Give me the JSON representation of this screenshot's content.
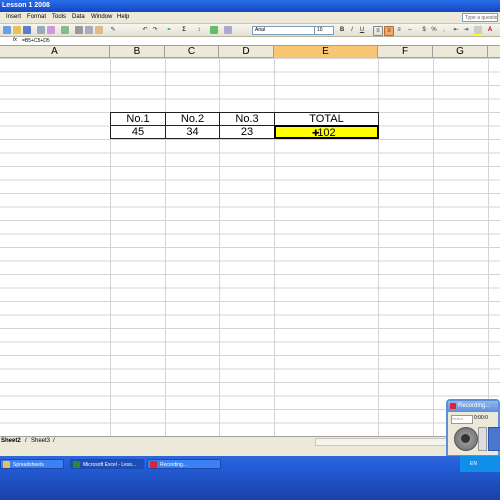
{
  "window": {
    "title": "Lesson 1 2008"
  },
  "menu": {
    "items": [
      "Insert",
      "Format",
      "Tools",
      "Data",
      "Window",
      "Help"
    ],
    "help_placeholder": "Type a questio"
  },
  "toolbar": {
    "font_name": "Arial",
    "font_size": "10",
    "bold": "B",
    "italic": "I",
    "underline": "U"
  },
  "formula_bar": {
    "fx": "fx",
    "formula": "=B5+C5+D5"
  },
  "columns": [
    "A",
    "B",
    "C",
    "D",
    "E",
    "F",
    "G"
  ],
  "selected_column": "E",
  "table": {
    "headers": [
      "No.1",
      "No.2",
      "No.3",
      "TOTAL"
    ],
    "values": [
      "45",
      "34",
      "23",
      "102"
    ]
  },
  "sheets": {
    "tab2": "Sheet2",
    "tab3": "Sheet3"
  },
  "taskbar": {
    "buttons": [
      "Spreadsheets",
      "Microsoft Excel - Less...",
      "Recording..."
    ],
    "lang": "EN"
  },
  "recorder": {
    "title": "Recording...",
    "select_placeholder": "Select",
    "time": "0:00:0"
  },
  "colors": {
    "selected_cell": "#ffff00",
    "selected_header": "#f8c673",
    "titlebar": "#1c55d4"
  }
}
